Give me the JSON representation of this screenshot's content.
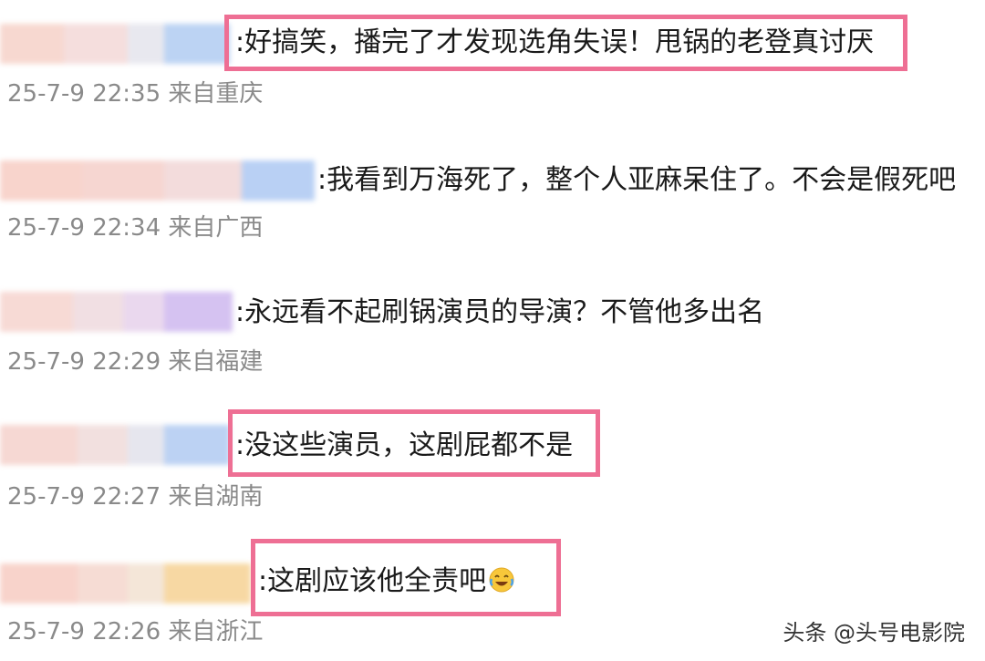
{
  "comments": [
    {
      "text": ":好搞笑，播完了才发现选角失误！甩锅的老登真讨厌",
      "meta": "25-7-9 22:35 来自重庆",
      "highlighted": true,
      "blur_colors": [
        "#f7d8d0",
        "#f5dedd",
        "#e8e8ef",
        "#bcd3f3"
      ]
    },
    {
      "text": ":我看到万海死了，整个人亚麻呆住了。不会是假死吧",
      "meta": "25-7-9 22:34 来自广西",
      "highlighted": false,
      "blur_colors": [
        "#f8d4cc",
        "#f6d6d1",
        "#f3dcdc",
        "#b9d0f4"
      ]
    },
    {
      "text": ":永远看不起刷锅演员的导演？不管他多出名",
      "meta": "25-7-9 22:29 来自福建",
      "highlighted": false,
      "blur_colors": [
        "#f7dad5",
        "#f1dfe3",
        "#ead8ee",
        "#d5c2f1"
      ]
    },
    {
      "text": ":没这些演员，这剧屁都不是",
      "meta": "25-7-9 22:27 来自湖南",
      "highlighted": true,
      "blur_colors": [
        "#f6d8d3",
        "#f2e0df",
        "#e6e6ee",
        "#bcd2f3"
      ]
    },
    {
      "text": ":这剧应该他全责吧",
      "meta": "25-7-9 22:26 来自浙江",
      "highlighted": true,
      "blur_colors": [
        "#f8d3cb",
        "#f6dcd4",
        "#f4e6d8",
        "#f7d8a3"
      ],
      "emoji": "laughing-crying-emoji"
    }
  ],
  "watermark": "头条 @头号电影院",
  "colors": {
    "highlight": "#ee6f94",
    "meta_text": "#8a8a8a",
    "comment_text": "#1a1a1a"
  }
}
